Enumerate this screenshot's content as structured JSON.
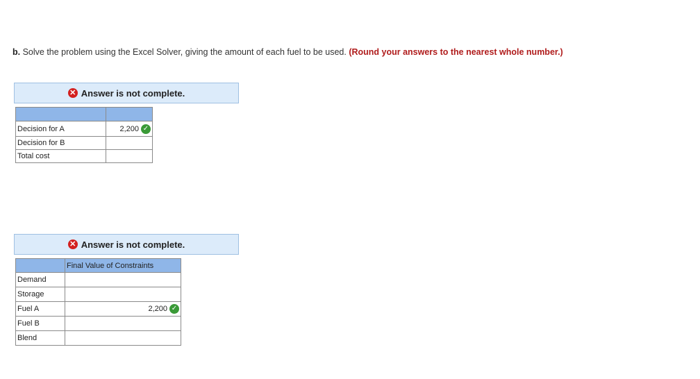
{
  "prompt": {
    "label": "b.",
    "text": " Solve the problem using the Excel Solver, giving the amount of each fuel to be used. ",
    "instruction": "(Round your answers to the nearest whole number.)"
  },
  "section1": {
    "banner": "Answer is not complete.",
    "header": "",
    "rows": [
      {
        "label": "Decision for A",
        "value": "2,200"
      },
      {
        "label": "Decision for B",
        "value": ""
      },
      {
        "label": "Total cost",
        "value": ""
      }
    ]
  },
  "section2": {
    "banner": "Answer is not complete.",
    "header": "Final Value of Constraints",
    "rows": [
      {
        "label": "Demand",
        "value": ""
      },
      {
        "label": "Storage",
        "value": ""
      },
      {
        "label": "Fuel A",
        "value": "2,200"
      },
      {
        "label": "Fuel B",
        "value": ""
      },
      {
        "label": "Blend",
        "value": ""
      }
    ]
  },
  "icons": {
    "incorrect": "x-circle-icon",
    "correct": "check-circle-icon"
  },
  "colors": {
    "instruction": "#b01c1c",
    "banner_bg": "#dcebfa",
    "header_bg": "#8fb6e8",
    "check": "#3a9a37",
    "x": "#d3201f"
  }
}
